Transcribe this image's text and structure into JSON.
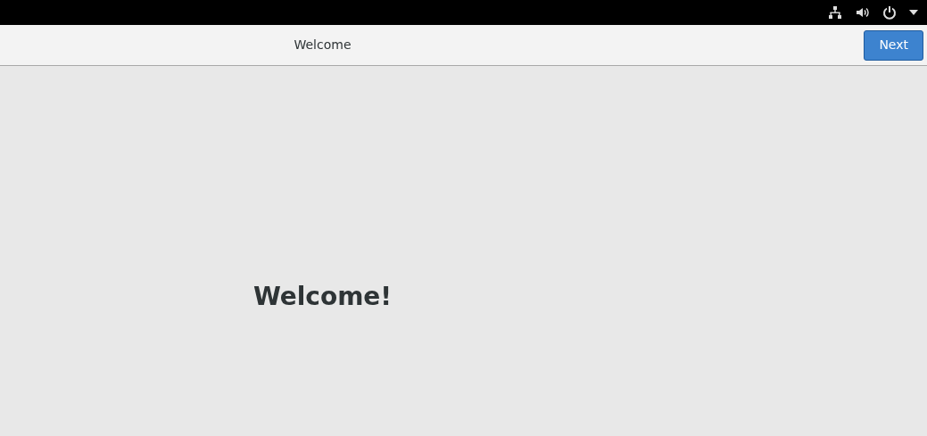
{
  "header": {
    "title": "Welcome",
    "next_button": "Next"
  },
  "content": {
    "heading": "Welcome!"
  }
}
